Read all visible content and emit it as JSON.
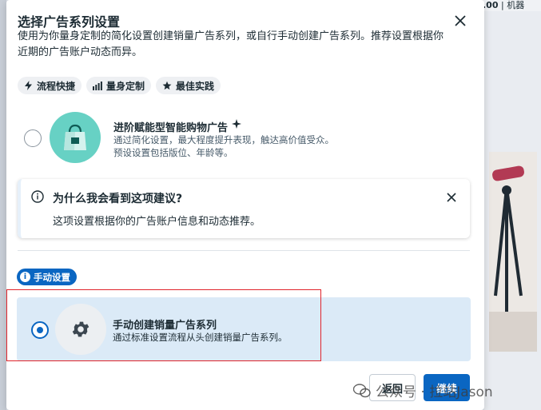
{
  "background": {
    "topbar_value": ".00",
    "topbar_tag": "| 机器"
  },
  "dialog": {
    "title": "选择广告系列设置",
    "description": "使用为你量身定制的简化设置创建销量广告系列，或自行手动创建广告系列。推荐设置根据你近期的广告账户动态而异。",
    "chips": [
      {
        "icon": "lightning-icon",
        "label": "流程快捷"
      },
      {
        "icon": "bar-chart-icon",
        "label": "量身定制"
      },
      {
        "icon": "star-icon",
        "label": "最佳实践"
      }
    ],
    "advantage_option": {
      "title": "进阶赋能型智能购物广告",
      "sparkle_icon": "sparkle-icon",
      "desc_line1": "通过简化设置，最大程度提升表现，触达高价值受众。",
      "desc_line2": "预设设置包括版位、年龄等。",
      "selected": false
    },
    "info_box": {
      "title": "为什么我会看到这项建议?",
      "body": "这项设置根据你的广告账户信息和动态推荐。"
    },
    "manual_badge": "手动设置",
    "manual_option": {
      "title": "手动创建销量广告系列",
      "desc": "通过标准设置流程从头创建销量广告系列。",
      "selected": true
    },
    "buttons": {
      "back": "返回",
      "continue": "继续"
    }
  },
  "watermark": "公众号 · 拉站Jason",
  "colors": {
    "primary": "#0a66c2",
    "selected_bg": "#dbeaf7",
    "illustration_teal": "#67d1c4",
    "highlight_red": "#e0242b"
  }
}
